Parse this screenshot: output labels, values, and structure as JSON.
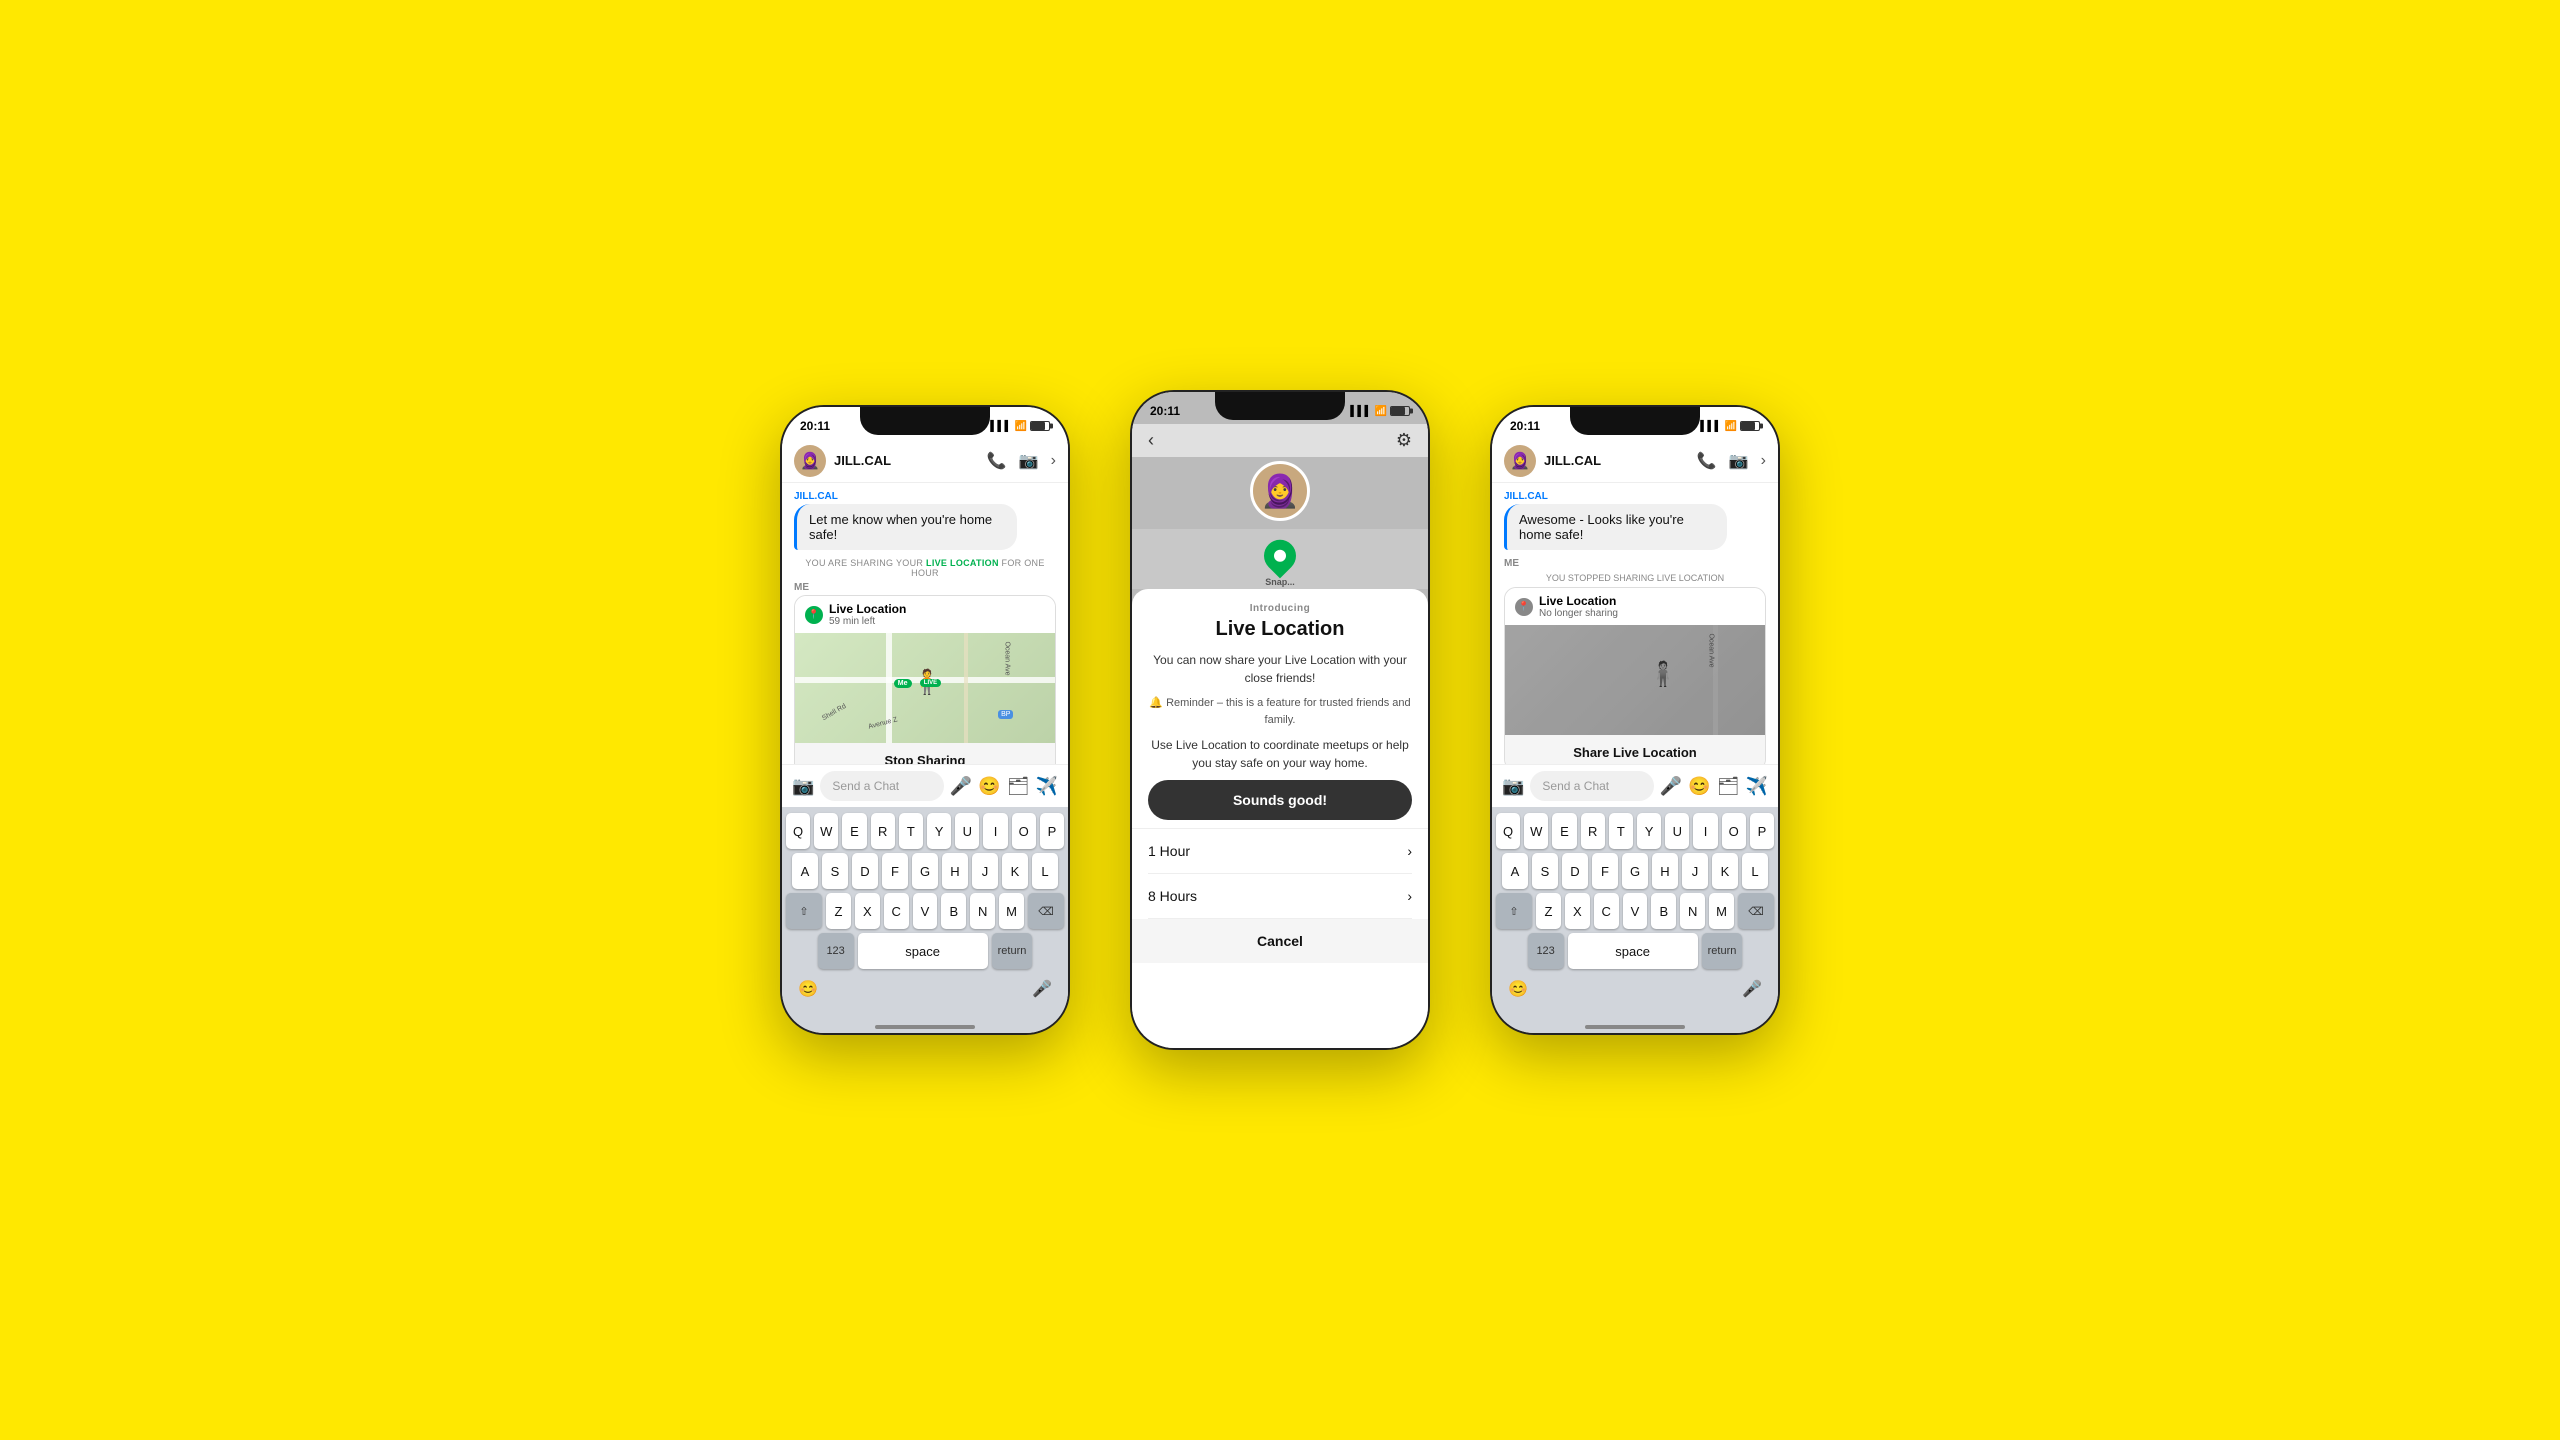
{
  "background_color": "#FFE800",
  "phones": [
    {
      "id": "phone-left",
      "status_bar": {
        "time": "20:11",
        "signal": "▌▌▌",
        "wifi": "WiFi",
        "battery": "80%"
      },
      "header": {
        "username": "JILL.CAL",
        "icons": [
          "phone",
          "camera",
          "chevron-right"
        ]
      },
      "chat": {
        "sender": "JILL.CAL",
        "bubble_text": "Let me know when you're home safe!",
        "notice": "YOU ARE SHARING YOUR LIVE LOCATION FOR ONE HOUR",
        "live_location_label": "LIVE LOCATION",
        "me_label": "ME",
        "ll_card": {
          "title": "Live Location",
          "subtitle": "59 min left",
          "stop_btn": "Stop Sharing"
        }
      },
      "input_placeholder": "Send a Chat",
      "keyboard": {
        "rows": [
          [
            "Q",
            "W",
            "E",
            "R",
            "T",
            "Y",
            "U",
            "I",
            "O",
            "P"
          ],
          [
            "A",
            "S",
            "D",
            "F",
            "G",
            "H",
            "J",
            "K",
            "L"
          ],
          [
            "⇧",
            "Z",
            "X",
            "C",
            "V",
            "B",
            "N",
            "M",
            "⌫"
          ],
          [
            "123",
            "space",
            "return"
          ]
        ]
      }
    },
    {
      "id": "phone-middle",
      "status_bar": {
        "time": "20:11",
        "signal": "▌▌▌",
        "wifi": "WiFi",
        "battery": "80%"
      },
      "modal": {
        "introducing": "Introducing",
        "title": "Live Location",
        "desc": "You can now share your Live Location with your close friends!",
        "reminder": "🔔 Reminder – this is a feature for trusted friends and family.",
        "use_text": "Use Live Location to coordinate meetups or help you stay safe on your way home.",
        "cta": "Sounds good!",
        "options": [
          {
            "label": "1 Hour",
            "icon": "›"
          },
          {
            "label": "8 Hours",
            "icon": "›"
          }
        ],
        "cancel": "Cancel"
      }
    },
    {
      "id": "phone-right",
      "status_bar": {
        "time": "20:11",
        "signal": "▌▌▌",
        "wifi": "WiFi",
        "battery": "80%"
      },
      "header": {
        "username": "JILL.CAL",
        "icons": [
          "phone",
          "camera",
          "chevron-right"
        ]
      },
      "chat": {
        "sender": "JILL.CAL",
        "bubble_text": "Awesome - Looks like you're home safe!",
        "me_label": "ME",
        "notice": "YOU STOPPED SHARING LIVE LOCATION",
        "ll_card": {
          "title": "Live Location",
          "subtitle": "No longer sharing",
          "share_btn": "Share Live Location"
        }
      },
      "input_placeholder": "Send a Chat",
      "keyboard": {
        "rows": [
          [
            "Q",
            "W",
            "E",
            "R",
            "T",
            "Y",
            "U",
            "I",
            "O",
            "P"
          ],
          [
            "A",
            "S",
            "D",
            "F",
            "G",
            "H",
            "J",
            "K",
            "L"
          ],
          [
            "⇧",
            "Z",
            "X",
            "C",
            "V",
            "B",
            "N",
            "M",
            "⌫"
          ],
          [
            "123",
            "space",
            "return"
          ]
        ]
      }
    }
  ]
}
